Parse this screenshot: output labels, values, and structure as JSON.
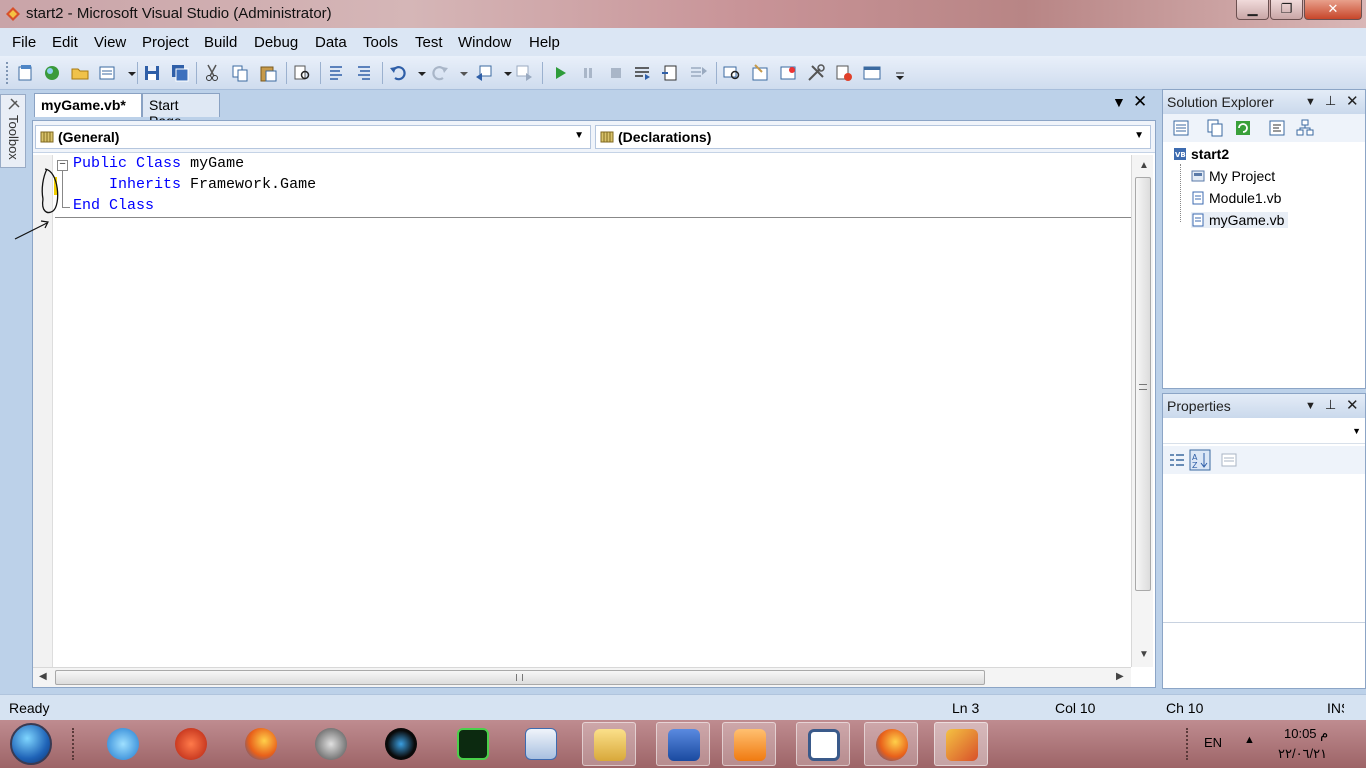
{
  "window": {
    "title": "start2 - Microsoft Visual Studio (Administrator)",
    "min": "▁",
    "max": "❐",
    "close": "✕"
  },
  "menu": [
    "File",
    "Edit",
    "View",
    "Project",
    "Build",
    "Debug",
    "Data",
    "Tools",
    "Test",
    "Window",
    "Help"
  ],
  "toolbox": {
    "label": "Toolbox"
  },
  "tabs": {
    "active": "myGame.vb*",
    "inactive": "Start Page"
  },
  "editor": {
    "left_combo": "(General)",
    "right_combo": "(Declarations)",
    "code": {
      "l1_kw1": "Public",
      "l1_kw2": "Class",
      "l1_name": "myGame",
      "l2_kw": "Inherits",
      "l2_rest": "Framework.Game",
      "l3_kw1": "End",
      "l3_kw2": "Class"
    }
  },
  "solution_explorer": {
    "title": "Solution Explorer",
    "items": [
      "start2",
      "My Project",
      "Module1.vb",
      "myGame.vb"
    ]
  },
  "properties": {
    "title": "Properties"
  },
  "status": {
    "ready": "Ready",
    "ln": "Ln 3",
    "col": "Col 10",
    "ch": "Ch 10",
    "ins": "INS"
  },
  "tray": {
    "lang": "EN",
    "time": "10:05 م",
    "date": "٢٢/٠٦/٢١"
  }
}
